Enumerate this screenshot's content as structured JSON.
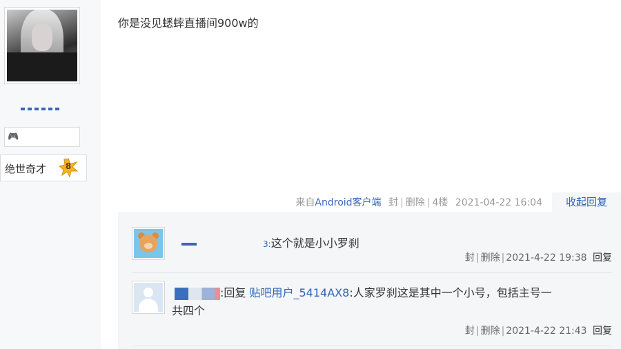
{
  "author": {
    "level_title": "绝世奇才",
    "level_number": "8"
  },
  "post": {
    "content": "你是没见蟋蟀直播间900w的",
    "source_prefix": "来自",
    "source_client": "Android客户端",
    "action_block": "封",
    "action_delete": "删除",
    "floor": "4楼",
    "timestamp": "2021-04-22 16:04",
    "collapse_label": "收起回复"
  },
  "replies": [
    {
      "name_tail": "3:",
      "content": "这个就是小小罗刹",
      "action_block": "封",
      "action_delete": "删除",
      "timestamp": "2021-4-22 19:38",
      "reply_label": "回复"
    },
    {
      "reply_prefix": ":回复",
      "reply_to": "贴吧用户_5414AX8",
      "content_line1": ":人家罗刹这是其中一个小号，包括主号一",
      "content_line2": "共四个",
      "action_block": "封",
      "action_delete": "删除",
      "timestamp": "2021-4-22 21:43",
      "reply_label": "回复"
    }
  ],
  "colors": {
    "link": "#2d64b3",
    "reply_bg": "#f5f6f8",
    "sidebar_bg": "#f7f8fa"
  }
}
